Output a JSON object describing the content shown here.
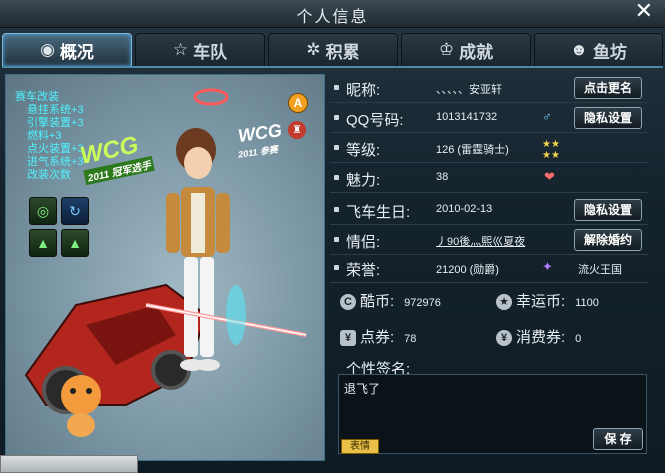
{
  "window": {
    "title": "个人信息",
    "close_icon": "close-icon"
  },
  "tabs": [
    {
      "label": "概况",
      "icon": "overview-icon",
      "active": true
    },
    {
      "label": "车队",
      "icon": "star-icon",
      "active": false
    },
    {
      "label": "积累",
      "icon": "gear-icon",
      "active": false
    },
    {
      "label": "成就",
      "icon": "achievement-icon",
      "active": false
    },
    {
      "label": "鱼坊",
      "icon": "fish-icon",
      "active": false
    }
  ],
  "avatar": {
    "mods": [
      "赛车改装",
      "悬挂系统+3",
      "引擎装置+3",
      "燃料+3",
      "点火装置+3",
      "进气系统+3",
      "改装次数"
    ],
    "badge_a": "A",
    "wcg_left": "WCG",
    "wcg_left_sub": "2011 冠军选手",
    "wcg_right": "WCG",
    "wcg_right_sub": "2011 参赛"
  },
  "profile": {
    "nickname_label": "昵称:",
    "nickname": "、、、、、安亚轩",
    "rename_button": "点击更名",
    "qq_label": "QQ号码:",
    "qq": "1013141732",
    "privacy_button": "隐私设置",
    "level_label": "等级:",
    "level": "126 (雷霆骑士)",
    "charm_label": "魅力:",
    "charm": "38",
    "birthday_label": "飞车生日:",
    "birthday": "2010-02-13",
    "privacy_button2": "隐私设置",
    "partner_label": "情侣:",
    "partner": "丿90後灬熙巛夏夜",
    "divorce_button": "解除婚约",
    "honor_label": "荣誉:",
    "honor": "21200 (勋爵)",
    "kingdom": "流火王国"
  },
  "currency": {
    "cool_label": "酷币:",
    "cool": "972976",
    "lucky_label": "幸运币:",
    "lucky": "1100",
    "points_label": "点券:",
    "points": "78",
    "voucher_label": "消费券:",
    "voucher": "0"
  },
  "signature": {
    "label": "个性签名:",
    "text": "退飞了",
    "emoji_button": "表情",
    "save_button": "保 存"
  },
  "colors": {
    "accent": "#4aa6e0",
    "link": "#57c6ff",
    "panel": "#15232d"
  }
}
